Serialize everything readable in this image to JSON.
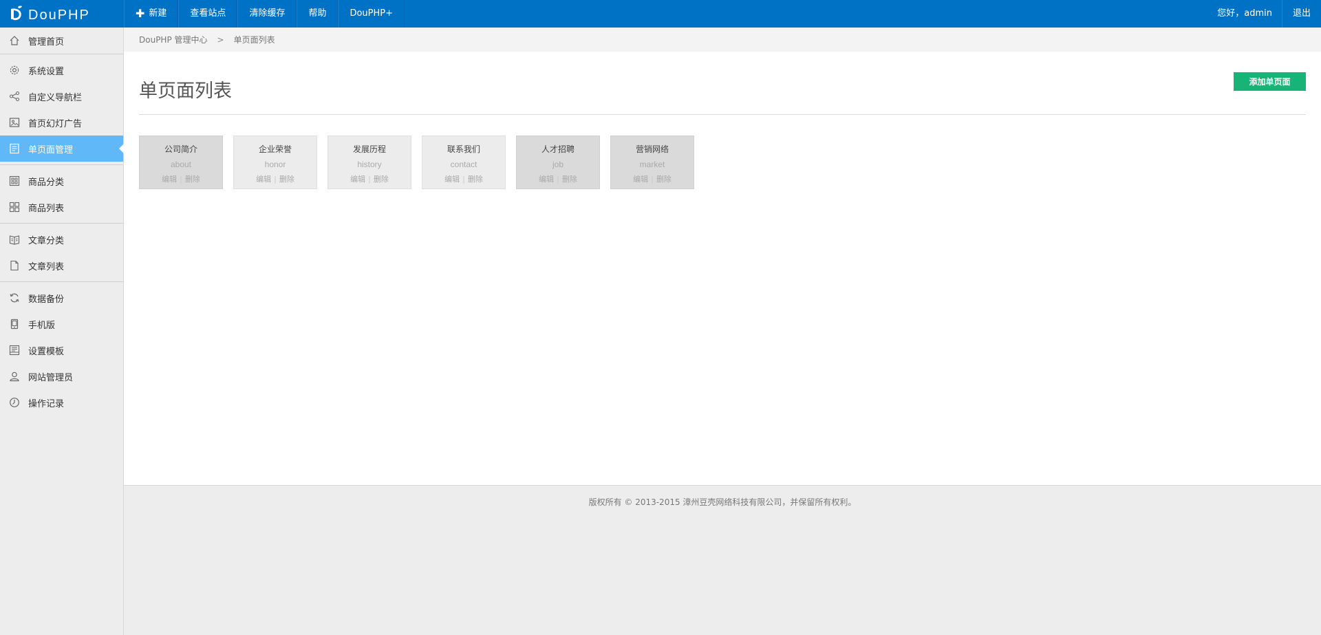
{
  "brand": {
    "name": "DouPHP"
  },
  "topnav": {
    "items": [
      {
        "label": "新建",
        "has_plus": true
      },
      {
        "label": "查看站点"
      },
      {
        "label": "清除缓存"
      },
      {
        "label": "帮助"
      },
      {
        "label": "DouPHP+"
      }
    ],
    "greeting": "您好，admin",
    "logout": "退出"
  },
  "sidebar": {
    "items": [
      {
        "label": "管理首页",
        "icon": "home-icon"
      },
      {
        "label": "系统设置",
        "icon": "gear-icon"
      },
      {
        "label": "自定义导航栏",
        "icon": "share-icon"
      },
      {
        "label": "首页幻灯广告",
        "icon": "image-icon"
      },
      {
        "label": "单页面管理",
        "icon": "page-icon",
        "active": true
      },
      {
        "label": "商品分类",
        "icon": "grid-icon"
      },
      {
        "label": "商品列表",
        "icon": "apps-icon"
      },
      {
        "label": "文章分类",
        "icon": "book-icon"
      },
      {
        "label": "文章列表",
        "icon": "document-icon"
      },
      {
        "label": "数据备份",
        "icon": "refresh-icon"
      },
      {
        "label": "手机版",
        "icon": "mobile-icon"
      },
      {
        "label": "设置模板",
        "icon": "template-icon"
      },
      {
        "label": "网站管理员",
        "icon": "user-icon"
      },
      {
        "label": "操作记录",
        "icon": "clock-icon"
      }
    ]
  },
  "breadcrumb": {
    "root": "DouPHP 管理中心",
    "separator": ">",
    "current": "单页面列表"
  },
  "main": {
    "title": "单页面列表",
    "add_button": "添加单页面",
    "pages": [
      {
        "name": "公司简介",
        "key": "about",
        "shade": "dark"
      },
      {
        "name": "企业荣誉",
        "key": "honor",
        "shade": "light"
      },
      {
        "name": "发展历程",
        "key": "history",
        "shade": "light"
      },
      {
        "name": "联系我们",
        "key": "contact",
        "shade": "light"
      },
      {
        "name": "人才招聘",
        "key": "job",
        "shade": "dark"
      },
      {
        "name": "营销网络",
        "key": "market",
        "shade": "dark"
      }
    ],
    "edit_label": "编辑",
    "delete_label": "删除",
    "action_separator": "|"
  },
  "footer": {
    "copyright": "版权所有 © 2013-2015 漳州豆壳网络科技有限公司，并保留所有权利。"
  },
  "colors": {
    "topbar": "#0072c6",
    "active_menu": "#60b8f8",
    "add_button": "#19b377"
  }
}
